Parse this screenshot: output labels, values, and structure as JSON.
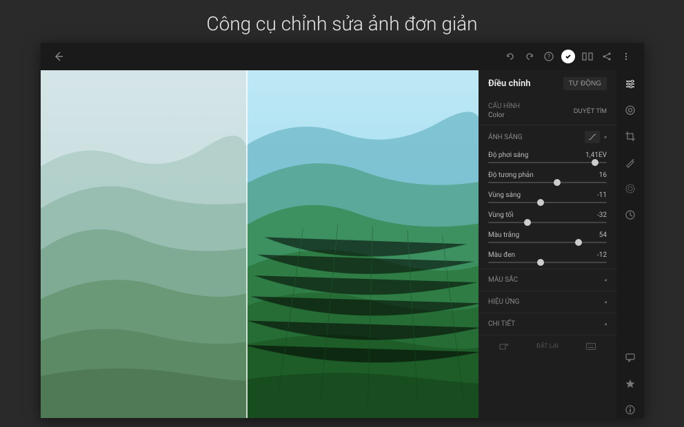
{
  "hero_title": "Công cụ chỉnh sửa ảnh đơn giản",
  "topbar": {},
  "adjust": {
    "title": "Điều chỉnh",
    "auto_label": "TỰ ĐỘNG",
    "profile": {
      "label": "CẤU HÌNH",
      "value": "Color",
      "browse": "DUYỆT TÌM"
    },
    "light": {
      "header": "ÁNH SÁNG",
      "sliders": [
        {
          "label": "Độ phơi sáng",
          "value": "1,41EV",
          "pos": 90
        },
        {
          "label": "Độ tương phản",
          "value": "16",
          "pos": 58
        },
        {
          "label": "Vùng sáng",
          "value": "-11",
          "pos": 44
        },
        {
          "label": "Vùng tối",
          "value": "-32",
          "pos": 33
        },
        {
          "label": "Màu trắng",
          "value": "54",
          "pos": 76
        },
        {
          "label": "Màu đen",
          "value": "-12",
          "pos": 44
        }
      ]
    },
    "collapsed": [
      {
        "label": "MÀU SẮC"
      },
      {
        "label": "HIỆU ỨNG"
      },
      {
        "label": "CHI TIẾT"
      }
    ],
    "footer": {
      "reset": "ĐẶT LẠI"
    }
  }
}
